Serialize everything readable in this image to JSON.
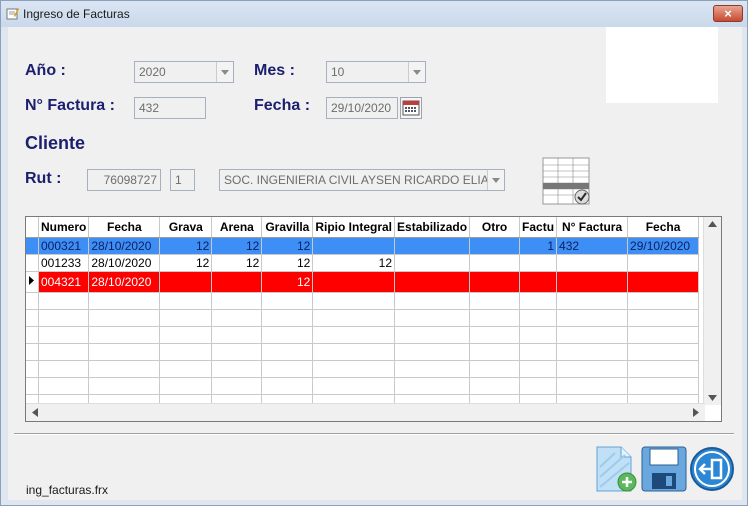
{
  "window": {
    "title": "Ingreso de Facturas",
    "close_label": "×"
  },
  "form": {
    "anio_label": "Año :",
    "anio_value": "2020",
    "mes_label": "Mes :",
    "mes_value": "10",
    "factura_label": "N° Factura :",
    "factura_value": "432",
    "fecha_label": "Fecha :",
    "fecha_value": "29/10/2020",
    "cliente_label": "Cliente",
    "rut_label": "Rut :",
    "rut_value": "76098727",
    "rut_dv": "1",
    "cliente_value": "SOC. INGENIERIA CIVIL AYSEN RICARDO ELIA"
  },
  "grid": {
    "columns": [
      "Numero",
      "Fecha",
      "Grava",
      "Arena",
      "Gravilla",
      "Ripio Integral",
      "Estabilizado",
      "Otro",
      "Factu",
      "N° Factura",
      "Fecha"
    ],
    "rows": [
      [
        "000321",
        "28/10/2020",
        "12",
        "12",
        "12",
        "",
        "",
        "",
        "1",
        "432",
        "29/10/2020"
      ],
      [
        "001233",
        "28/10/2020",
        "12",
        "12",
        "12",
        "12",
        "",
        "",
        "",
        "",
        ""
      ],
      [
        "004321",
        "28/10/2020",
        "",
        "",
        "12",
        "",
        "",
        "",
        "",
        "",
        ""
      ]
    ]
  },
  "footer": {
    "form_name": "ing_facturas.frx"
  },
  "colors": {
    "selected_row": "#3d8ef5",
    "highlight_row": "#ff0000",
    "label": "#1c1f6e"
  }
}
